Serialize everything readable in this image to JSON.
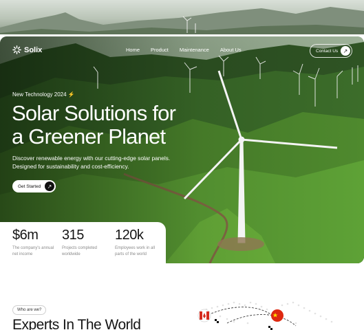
{
  "brand": {
    "name": "Solix"
  },
  "nav": {
    "links": [
      {
        "label": "Home"
      },
      {
        "label": "Product"
      },
      {
        "label": "Maintenance"
      },
      {
        "label": "About Us"
      }
    ],
    "contact_label": "Contact Us"
  },
  "hero": {
    "tag": "New Technology 2024",
    "headline_line1": "Solar Solutions for",
    "headline_line2": "a Greener Planet",
    "subtitle_line1": "Discover renewable energy with our cutting-edge solar panels.",
    "subtitle_line2": "Designed for sustainability and cost-efficiency.",
    "cta_label": "Get Started"
  },
  "stats": [
    {
      "value": "$6m",
      "label": "The company's annual net income"
    },
    {
      "value": "315",
      "label": "Projects completed worldwide"
    },
    {
      "value": "120k",
      "label": "Employees work in all parts of the world"
    }
  ],
  "about": {
    "chip": "Who are we?",
    "heading": "Experts In The World"
  },
  "icons": {
    "logo": "snowflake-logo-icon",
    "arrow": "arrow-up-right-icon",
    "bolt": "lightning-icon"
  },
  "colors": {
    "accent": "#111111",
    "hero_green": "#4f8a2e",
    "bolt": "#f4d34a"
  }
}
